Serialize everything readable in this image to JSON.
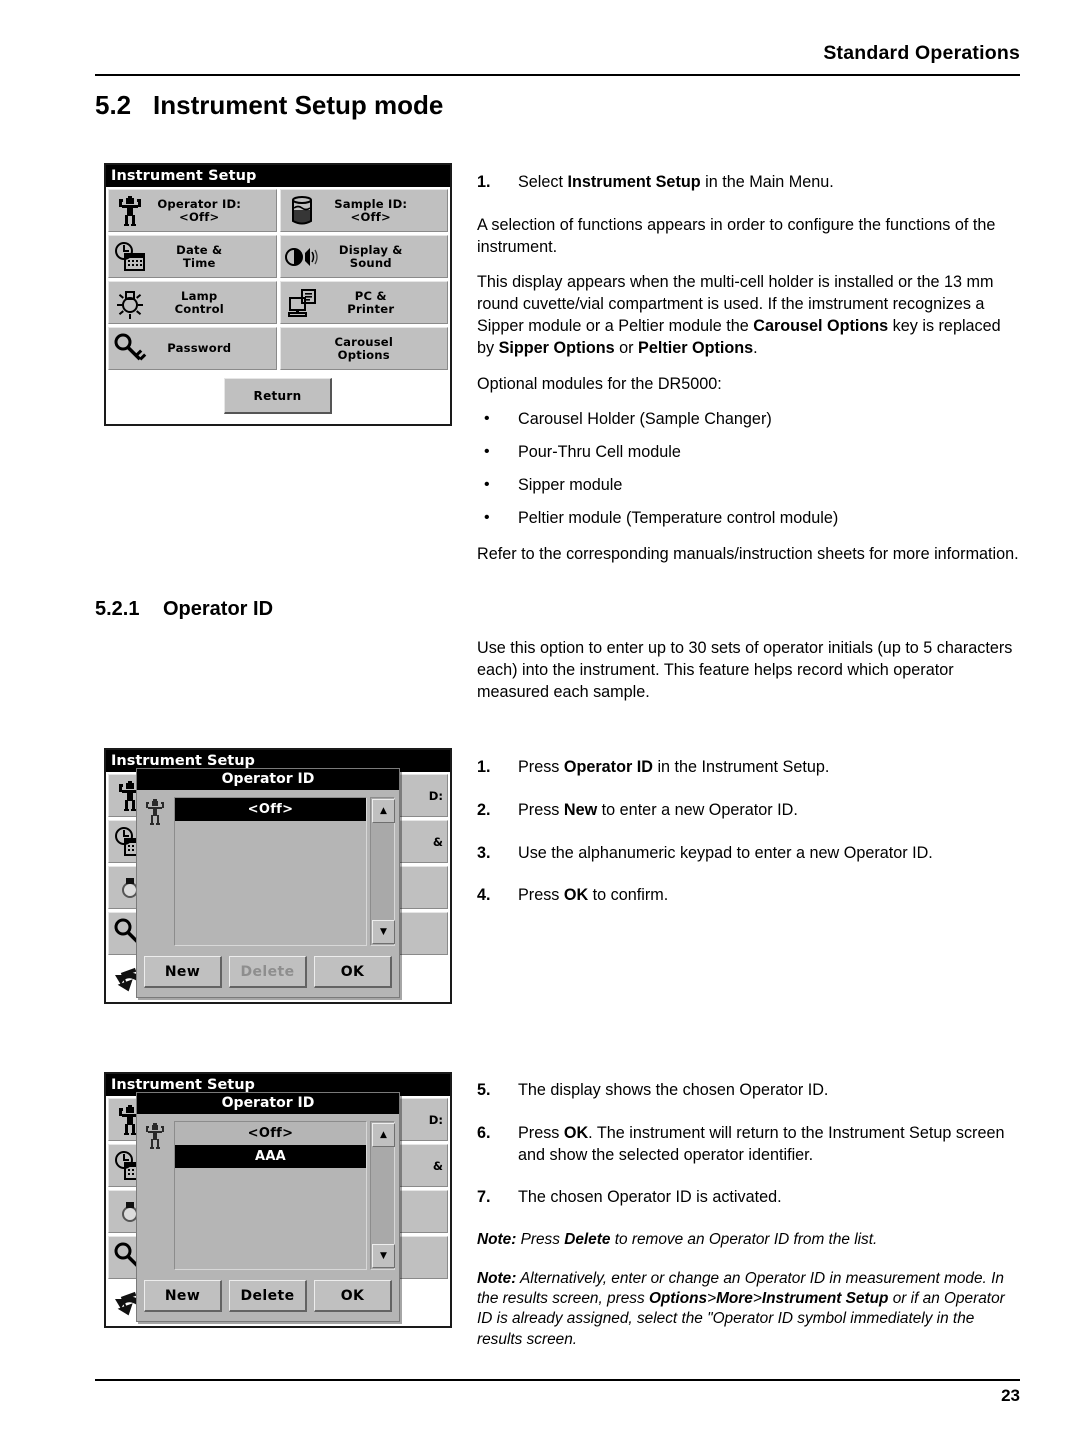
{
  "header": {
    "running_head": "Standard Operations"
  },
  "section": {
    "number": "5.2",
    "title": "Instrument Setup mode",
    "sub_number": "5.2.1",
    "sub_title": "Operator ID"
  },
  "footer": {
    "page_number": "23"
  },
  "intro": {
    "steps": [
      {
        "n": "1.",
        "html": "Select <b>Instrument Setup</b> in the Main Menu."
      }
    ],
    "paragraphs": [
      "A selection of functions appears in order to configure the functions of the instrument.",
      "This display appears when the multi-cell holder is installed or the 13 mm round cuvette/vial compartment is used. If the imstrument recognizes a Sipper module or a Peltier module the <b>Carousel Options</b> key is replaced by <b>Sipper Options</b> or <b>Peltier Options</b>.",
      "Optional modules for the DR5000:"
    ],
    "bullets": [
      "Carousel Holder (Sample Changer)",
      "Pour-Thru Cell module",
      "Sipper module",
      "Peltier module (Temperature control module)"
    ],
    "closing": "Refer to the corresponding manuals/instruction sheets for more information."
  },
  "operator_id": {
    "description": "Use this option to enter up to 30 sets of operator initials (up to 5 characters each) into the instrument. This feature helps record which operator measured each sample.",
    "steps_first": [
      {
        "n": "1.",
        "html": "Press <b>Operator ID</b> in the Instrument Setup."
      },
      {
        "n": "2.",
        "html": "Press <b>New</b> to enter a new Operator ID."
      },
      {
        "n": "3.",
        "html": "Use the alphanumeric keypad to enter a new Operator ID."
      },
      {
        "n": "4.",
        "html": "Press <b>OK</b> to confirm."
      }
    ],
    "steps_second": [
      {
        "n": "5.",
        "html": "The display shows the chosen Operator ID."
      },
      {
        "n": "6.",
        "html": "Press <b>OK</b>. The instrument will return to the Instrument Setup screen and show the selected operator identifier."
      },
      {
        "n": "7.",
        "html": "The chosen Operator ID is activated."
      }
    ],
    "notes": [
      "<b>Note:</b> Press <b>Delete</b> to remove an Operator ID from the list.",
      "<b>Note:</b> Alternatively, enter or change an Operator ID in measurement mode. In the results screen, press <b>Options</b>&gt;<b>More</b>&gt;<b>Instrument Setup</b> or if an Operator ID is already assigned, select the \"Operator ID symbol immediately in the results screen."
    ]
  },
  "screens": {
    "instrument_setup": {
      "title": "Instrument Setup",
      "keys": [
        {
          "icon": "operator-person-icon",
          "label": "Operator ID:\n<Off>"
        },
        {
          "icon": "sample-beaker-icon",
          "label": "Sample ID:\n<Off>"
        },
        {
          "icon": "clock-calendar-icon",
          "label": "Date &\nTime"
        },
        {
          "icon": "display-sound-icon",
          "label": "Display &\nSound"
        },
        {
          "icon": "lamp-icon",
          "label": "Lamp\nControl"
        },
        {
          "icon": "pc-printer-icon",
          "label": "PC &\nPrinter"
        },
        {
          "icon": "key-password-icon",
          "label": "Password"
        },
        {
          "icon": "none",
          "label": "Carousel\nOptions"
        }
      ],
      "return_label": "Return"
    },
    "operator_dialog_1": {
      "background_title": "Instrument Setup",
      "background_fragments": [
        "D:",
        "&",
        "",
        ""
      ],
      "dialog_title": "Operator ID",
      "list": [
        {
          "text": "<Off>",
          "selected": true
        }
      ],
      "scroll_up": "▲",
      "scroll_down": "▼",
      "buttons": [
        {
          "label": "New",
          "disabled": false
        },
        {
          "label": "Delete",
          "disabled": true
        },
        {
          "label": "OK",
          "disabled": false
        }
      ]
    },
    "operator_dialog_2": {
      "background_title": "Instrument Setup",
      "background_fragments": [
        "D:",
        "&",
        "",
        ""
      ],
      "dialog_title": "Operator ID",
      "list": [
        {
          "text": "<Off>",
          "selected": false
        },
        {
          "text": "AAA",
          "selected": true
        }
      ],
      "scroll_up": "▲",
      "scroll_down": "▼",
      "buttons": [
        {
          "label": "New",
          "disabled": false
        },
        {
          "label": "Delete",
          "disabled": false
        },
        {
          "label": "OK",
          "disabled": false
        }
      ]
    }
  },
  "colors": {
    "key_face": "#c0c0c0",
    "dialog_face": "#b5b5b5",
    "titlebar": "#000000",
    "page": "#ffffff"
  }
}
